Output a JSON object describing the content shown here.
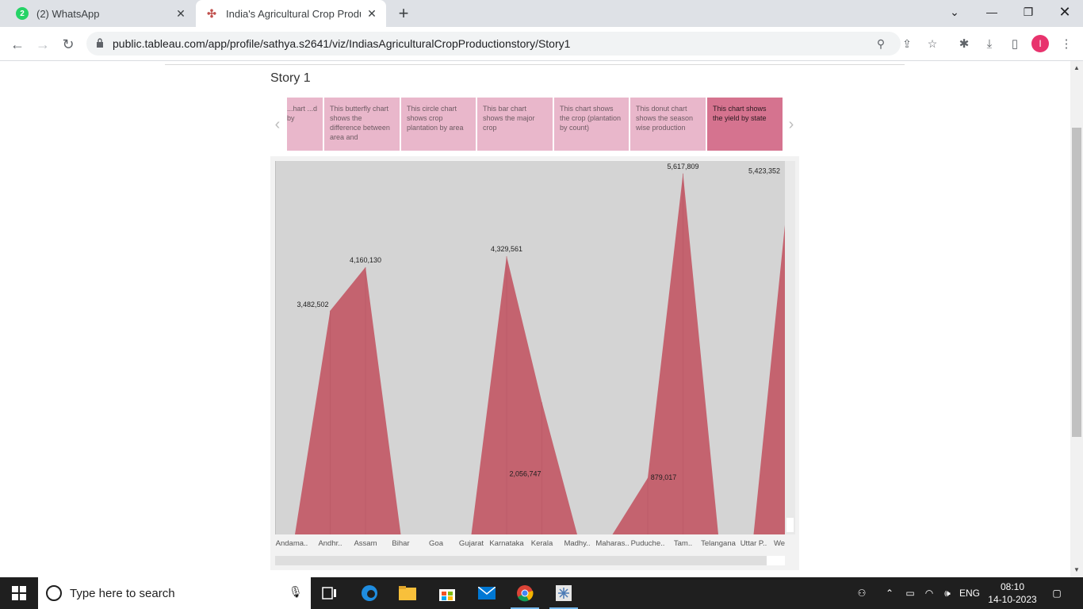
{
  "browser": {
    "tabs": [
      {
        "title": "(2) WhatsApp",
        "badge": "2",
        "icon": "whatsapp-icon",
        "active": false
      },
      {
        "title": "India's Agricultural Crop Product",
        "icon": "tableau-icon",
        "active": true
      }
    ],
    "url": "public.tableau.com/app/profile/sathya.s2641/viz/IndiasAgriculturalCropProductionstory/Story1",
    "profile_initial": "I"
  },
  "page": {
    "story_title": "Story 1",
    "story_points": [
      {
        "text": "...hart ...d by",
        "active": false
      },
      {
        "text": "This butterfly chart shows the difference between area and",
        "active": false
      },
      {
        "text": "This circle chart shows crop plantation by area",
        "active": false
      },
      {
        "text": "This bar chart shows the major crop",
        "active": false
      },
      {
        "text": "This chart shows the crop (plantation by count)",
        "active": false
      },
      {
        "text": "This donut chart shows the season wise production",
        "active": false
      },
      {
        "text": "This chart shows the yield by state",
        "active": true
      }
    ]
  },
  "chart_data": {
    "type": "area",
    "title": "",
    "xlabel": "",
    "ylabel": "",
    "categories": [
      "Andama..",
      "Andhr..",
      "Assam",
      "Bihar",
      "Goa",
      "Gujarat",
      "Karnataka",
      "Kerala",
      "Madhy..",
      "Maharas..",
      "Puduche..",
      "Tam..",
      "Telangana",
      "Uttar P..",
      "We"
    ],
    "values": [
      0,
      3482502,
      4160130,
      0,
      0,
      0,
      4329561,
      2056747,
      0,
      0,
      879017,
      5617809,
      0,
      0,
      5423352
    ],
    "data_labels": [
      "",
      "3,482,502",
      "4,160,130",
      "",
      "",
      "",
      "4,329,561",
      "2,056,747",
      "",
      "",
      "879,017",
      "5,617,809",
      "",
      "",
      "5,423,352"
    ],
    "color": "#c4636f",
    "ylim": [
      0,
      5800000
    ],
    "grid": false
  },
  "taskbar": {
    "search_placeholder": "Type here to search",
    "language": "ENG",
    "time": "08:10",
    "date": "14-10-2023",
    "apps": [
      "task-view-icon",
      "edge-icon",
      "file-explorer-icon",
      "store-icon",
      "mail-icon",
      "chrome-icon",
      "snipping-tool-icon"
    ]
  }
}
